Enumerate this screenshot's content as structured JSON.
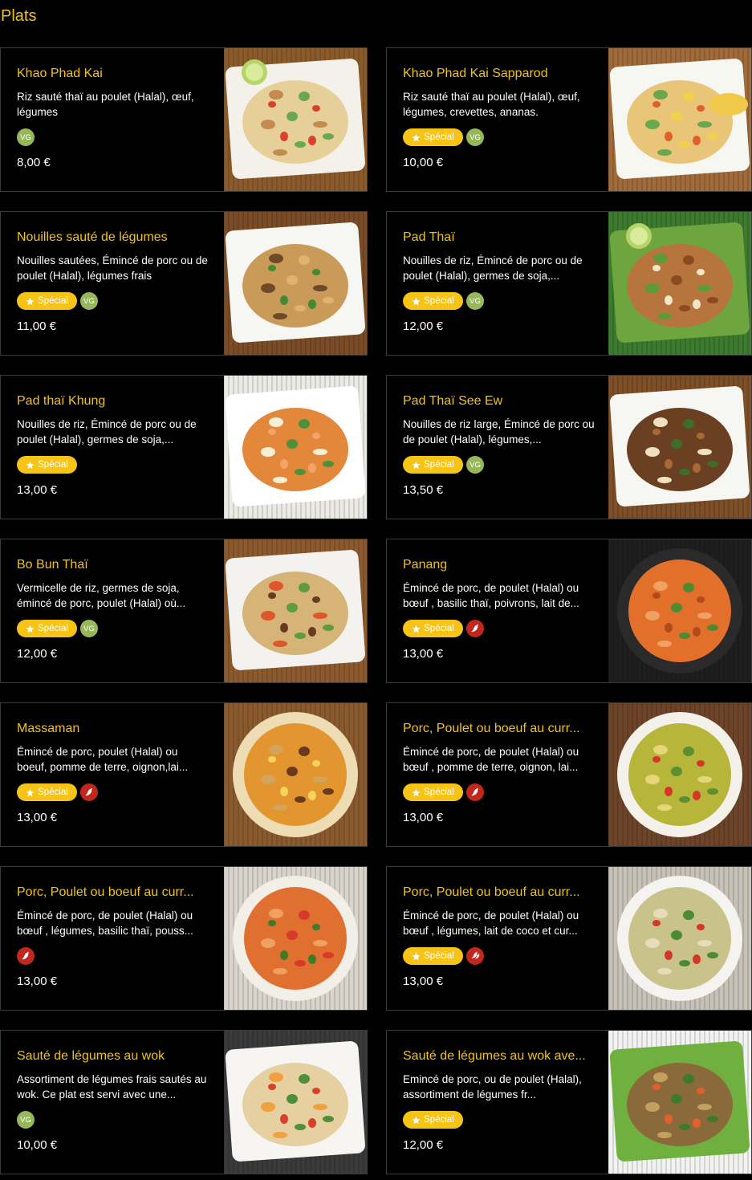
{
  "section_title": "Plats",
  "badge_labels": {
    "special": "Spécial",
    "vg": "VG"
  },
  "colors": {
    "accent": "#f2c21b",
    "special_badge": "#f6c317",
    "vg_badge": "#97b85a",
    "spicy_badge": "#c2271d",
    "background": "#000000"
  },
  "items": [
    {
      "title": "Khao Phad Kai",
      "description": "Riz sauté thaï au poulet (Halal), œuf, légumes",
      "price": "8,00 €",
      "special": false,
      "vg": true,
      "spicy": 0,
      "image": "fried-rice-plate"
    },
    {
      "title": "Khao Phad Kai Sapparod",
      "description": "Riz sauté thaï au poulet (Halal), œuf, légumes, crevettes, ananas.",
      "price": "10,00 €",
      "special": true,
      "vg": true,
      "spicy": 0,
      "image": "pineapple-fried-rice"
    },
    {
      "title": "Nouilles sauté de légumes",
      "description": "Nouilles sautées, Émincé de porc ou de poulet (Halal), légumes frais",
      "price": "11,00 €",
      "special": true,
      "vg": true,
      "spicy": 0,
      "image": "stir-fried-noodles"
    },
    {
      "title": "Pad Thaï",
      "description": "Nouilles de riz, Émincé de porc ou de poulet (Halal), germes de soja,...",
      "price": "12,00 €",
      "special": true,
      "vg": true,
      "spicy": 0,
      "image": "pad-thai-lime"
    },
    {
      "title": "Pad thaï Khung",
      "description": "Nouilles de riz, Émincé de porc ou de poulet (Halal), germes de soja,...",
      "price": "13,00 €",
      "special": true,
      "vg": false,
      "spicy": 0,
      "image": "pad-thai-shrimp"
    },
    {
      "title": "Pad Thaï See Ew",
      "description": "Nouilles de riz large, Émincé de porc ou de poulet (Halal), légumes,...",
      "price": "13,50 €",
      "special": true,
      "vg": true,
      "spicy": 0,
      "image": "wide-noodles"
    },
    {
      "title": "Bo Bun Thaï",
      "description": "Vermicelle de riz, germes de soja, émincé de porc, poulet (Halal) où...",
      "price": "12,00 €",
      "special": true,
      "vg": true,
      "spicy": 0,
      "image": "bo-bun-bowl"
    },
    {
      "title": "Panang",
      "description": "Émincé de porc, de poulet (Halal) ou bœuf , basilic thaï, poivrons, lait de...",
      "price": "13,00 €",
      "special": true,
      "vg": false,
      "spicy": 1,
      "image": "panang-curry"
    },
    {
      "title": "Massaman",
      "description": "Émincé de porc, poulet (Halal) ou boeuf, pomme de terre, oignon,lai...",
      "price": "13,00 €",
      "special": true,
      "vg": false,
      "spicy": 1,
      "image": "massaman-curry"
    },
    {
      "title": "Porc, Poulet ou boeuf au curr...",
      "description": "Émincé de porc, de poulet (Halal) ou bœuf , pomme de terre, oignon, lai...",
      "price": "13,00 €",
      "special": true,
      "vg": false,
      "spicy": 1,
      "image": "yellow-curry"
    },
    {
      "title": "Porc, Poulet ou boeuf au curr...",
      "description": "Émincé de porc, de poulet (Halal) ou bœuf , légumes, basilic thaï, pouss...",
      "price": "13,00 €",
      "special": false,
      "vg": false,
      "spicy": 1,
      "image": "red-curry"
    },
    {
      "title": "Porc, Poulet ou boeuf au curr...",
      "description": "Émincé de porc, de poulet (Halal) ou bœuf , légumes, lait de coco et cur...",
      "price": "13,00 €",
      "special": true,
      "vg": false,
      "spicy": 2,
      "image": "green-curry"
    },
    {
      "title": "Sauté de légumes au wok",
      "description": "Assortiment de légumes frais sautés au wok. Ce plat est servi avec une...",
      "price": "10,00 €",
      "special": false,
      "vg": true,
      "spicy": 0,
      "image": "wok-vegetables"
    },
    {
      "title": "Sauté de légumes au wok ave...",
      "description": "Emincé de porc, ou de poulet (Halal), assortiment de légumes fr...",
      "price": "12,00 €",
      "special": true,
      "vg": false,
      "spicy": 0,
      "image": "wok-vegetables-meat"
    }
  ]
}
